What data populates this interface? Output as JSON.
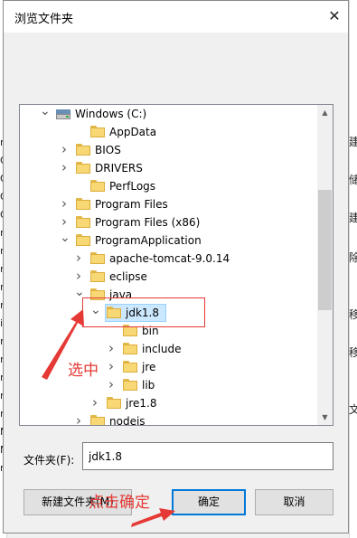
{
  "dialog": {
    "title": "浏览文件夹",
    "close_glyph": "✕"
  },
  "tree": {
    "items": [
      {
        "label": "Windows (C:)",
        "icon": "drive-icon",
        "expander": "expanded"
      },
      {
        "label": "AppData",
        "icon": "folder-icon",
        "expander": "none"
      },
      {
        "label": "BIOS",
        "icon": "folder-icon",
        "expander": "collapsed"
      },
      {
        "label": "DRIVERS",
        "icon": "folder-icon",
        "expander": "collapsed"
      },
      {
        "label": "PerfLogs",
        "icon": "folder-icon",
        "expander": "none"
      },
      {
        "label": "Program Files",
        "icon": "folder-icon",
        "expander": "collapsed"
      },
      {
        "label": "Program Files (x86)",
        "icon": "folder-icon",
        "expander": "collapsed"
      },
      {
        "label": "ProgramApplication",
        "icon": "folder-icon",
        "expander": "expanded"
      },
      {
        "label": "apache-tomcat-9.0.14",
        "icon": "folder-icon",
        "expander": "collapsed"
      },
      {
        "label": "eclipse",
        "icon": "folder-icon",
        "expander": "collapsed"
      },
      {
        "label": "java",
        "icon": "folder-icon",
        "expander": "expanded"
      },
      {
        "label": "jdk1.8",
        "icon": "folder-icon",
        "expander": "expanded",
        "selected": true
      },
      {
        "label": "bin",
        "icon": "folder-icon",
        "expander": "none"
      },
      {
        "label": "include",
        "icon": "folder-icon",
        "expander": "collapsed"
      },
      {
        "label": "jre",
        "icon": "folder-icon",
        "expander": "collapsed"
      },
      {
        "label": "lib",
        "icon": "folder-icon",
        "expander": "collapsed"
      },
      {
        "label": "jre1.8",
        "icon": "folder-icon",
        "expander": "collapsed"
      },
      {
        "label": "nodejs",
        "icon": "folder-icon",
        "expander": "collapsed"
      }
    ]
  },
  "folder_field": {
    "label": "文件夹(F):",
    "value": "jdk1.8"
  },
  "buttons": {
    "new_folder": "新建文件夹(M)",
    "ok": "确定",
    "cancel": "取消"
  },
  "annotations": {
    "select_text": "选中",
    "click_ok_text": "点击确定",
    "color": "#e53935"
  },
  "background": {
    "left_chars": [
      "r",
      "O",
      "O",
      "O",
      "O",
      "r",
      "r",
      "r",
      "r",
      "r",
      "i",
      "r",
      "r",
      "r",
      "r",
      "r",
      "M",
      "M",
      "r"
    ],
    "right_chars": [
      "建",
      "储",
      "建",
      "除",
      "移",
      "移",
      "文"
    ]
  }
}
